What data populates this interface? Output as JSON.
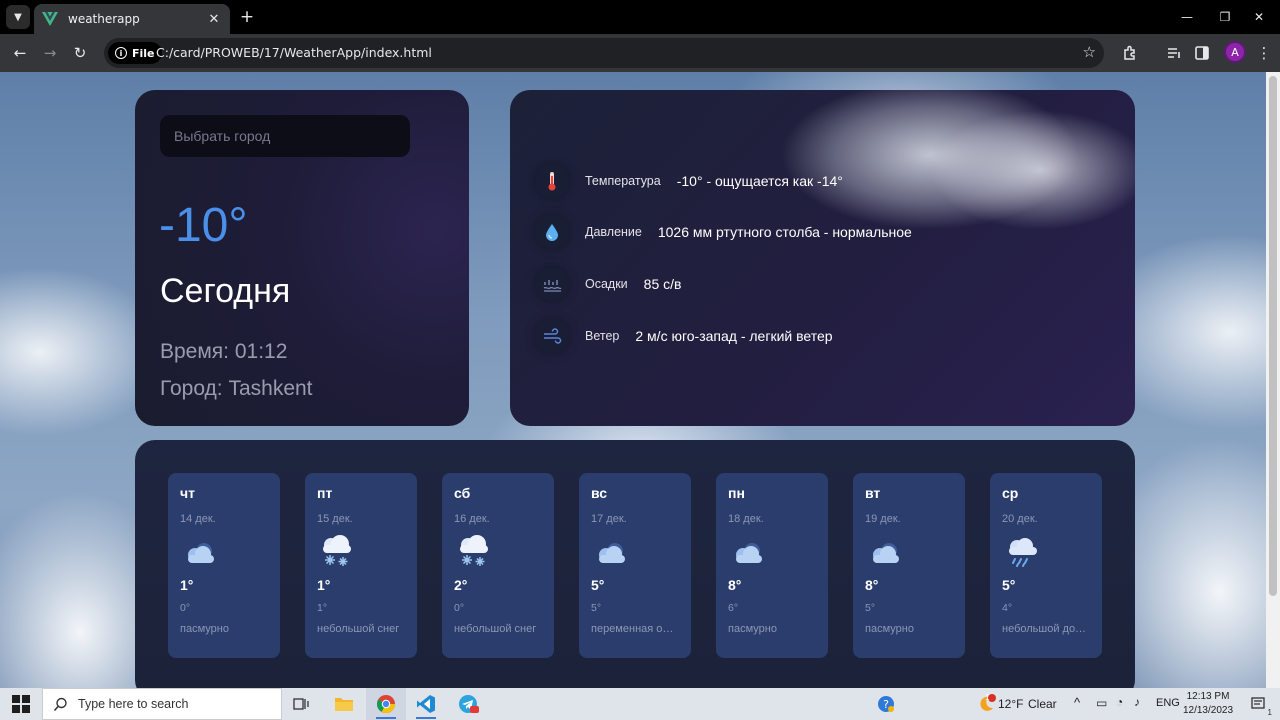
{
  "browser": {
    "tab_title": "weatherapp",
    "url_chip": "File",
    "url": "C:/card/PROWEB/17/WeatherApp/index.html",
    "profile_initial": "A"
  },
  "app": {
    "search_placeholder": "Выбрать город",
    "current_temp": "-10°",
    "today_label": "Сегодня",
    "time_line": "Время: 01:12",
    "city_line": "Город: Tashkent",
    "details": [
      {
        "icon": "thermometer-icon",
        "label": "Температура",
        "value": "-10° - ощущается как -14°"
      },
      {
        "icon": "droplet-icon",
        "label": "Давление",
        "value": "1026 мм ртутного столба - нормальное"
      },
      {
        "icon": "precipitation-icon",
        "label": "Осадки",
        "value": "85 с/в"
      },
      {
        "icon": "wind-icon",
        "label": "Ветер",
        "value": "2 м/с юго-запад - легкий ветер"
      }
    ],
    "forecast": [
      {
        "day": "чт",
        "date": "14 дек.",
        "icon": "cloud-icon",
        "max": "1°",
        "min": "0°",
        "desc": "пасмурно"
      },
      {
        "day": "пт",
        "date": "15 дек.",
        "icon": "snow-cloud-icon",
        "max": "1°",
        "min": "1°",
        "desc": "небольшой снег"
      },
      {
        "day": "сб",
        "date": "16 дек.",
        "icon": "snow-cloud-icon",
        "max": "2°",
        "min": "0°",
        "desc": "небольшой снег"
      },
      {
        "day": "вс",
        "date": "17 дек.",
        "icon": "cloud-icon",
        "max": "5°",
        "min": "5°",
        "desc": "переменная облачность"
      },
      {
        "day": "пн",
        "date": "18 дек.",
        "icon": "cloud-icon",
        "max": "8°",
        "min": "6°",
        "desc": "пасмурно"
      },
      {
        "day": "вт",
        "date": "19 дек.",
        "icon": "cloud-icon",
        "max": "8°",
        "min": "5°",
        "desc": "пасмурно"
      },
      {
        "day": "ср",
        "date": "20 дек.",
        "icon": "rain-cloud-icon",
        "max": "5°",
        "min": "4°",
        "desc": "небольшой дождь"
      }
    ]
  },
  "taskbar": {
    "search_text": "Type here to search",
    "weather_badge": "1",
    "weather_temp": "12°F",
    "weather_desc": "Clear",
    "language": "ENG",
    "time": "12:13 PM",
    "date": "12/13/2023",
    "notifications": "1"
  }
}
